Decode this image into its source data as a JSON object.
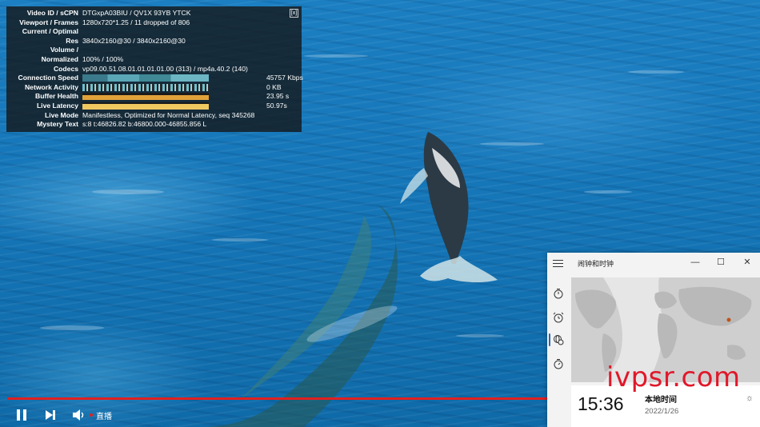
{
  "stats": {
    "close_label": "[x]",
    "rows": [
      {
        "label": "Video ID / sCPN",
        "value": "DTGxpA03BIU / QV1X 93YB YTCK"
      },
      {
        "label": "Viewport / Frames",
        "value": "1280x720*1.25 / 11 dropped of 806"
      },
      {
        "label": "Current / Optimal",
        "value": ""
      },
      {
        "label": "Res",
        "value": "3840x2160@30 / 3840x2160@30"
      },
      {
        "label": "Volume /",
        "value": ""
      },
      {
        "label": "Normalized",
        "value": "100% / 100%"
      },
      {
        "label": "Codecs",
        "value": "vp09.00.51.08.01.01.01.01.00 (313) / mp4a.40.2 (140)"
      },
      {
        "label": "Connection Speed",
        "value": "45757 Kbps"
      },
      {
        "label": "Network Activity",
        "value": "0 KB"
      },
      {
        "label": "Buffer Health",
        "value": "23.95 s"
      },
      {
        "label": "Live Latency",
        "value": "50.97s"
      },
      {
        "label": "Live Mode",
        "value": "Manifestless, Optimized for Normal Latency, seq 345268"
      },
      {
        "label": "Mystery Text",
        "value": "s:8 t:46826.82 b:46800.000-46855.856 L"
      }
    ]
  },
  "player": {
    "live_label": "直播",
    "progress_fraction": 1.0
  },
  "clock_app": {
    "title": "闹钟和时钟",
    "controls": {
      "minimize": "—",
      "maximize": "☐",
      "close": "✕"
    },
    "time": "15:36",
    "location": "本地时间",
    "date": "2022/1/26"
  },
  "watermark": "ivpsr.com",
  "colors": {
    "accent": "#e02020",
    "nav_selected": "#2a66c0",
    "map_pin": "#c0541a"
  }
}
